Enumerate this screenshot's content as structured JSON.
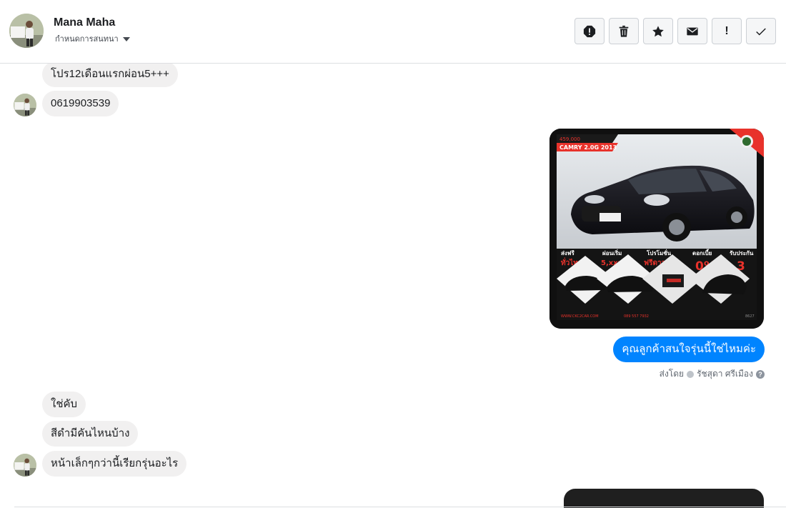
{
  "contact": {
    "name": "Mana Maha",
    "subtitle": "กำหนดการสนทนา"
  },
  "toolbar": {
    "buttons": [
      {
        "icon": "alert-circle-icon"
      },
      {
        "icon": "trash-icon"
      },
      {
        "icon": "star-icon"
      },
      {
        "icon": "envelope-icon"
      },
      {
        "icon": "exclamation-icon",
        "glyph": "!"
      },
      {
        "icon": "checkmark-icon"
      }
    ]
  },
  "messages": {
    "incoming_1": "โปร12เดือนแรกผ่อน5+++",
    "incoming_2": "0619903539",
    "outgoing_1": "คุณลูกค้าสนใจรุ่นนี้ใช่ไหมค่ะ",
    "incoming_3": "ใช่คับ",
    "incoming_4": "สีดำมีคันไหนบ้าง",
    "incoming_5": "หน้าเล็กๆกว่านี้เรียกรุ่นอะไร"
  },
  "photo": {
    "tag_price": "459,000",
    "tag_model": "CAMRY 2.0G 2013",
    "features": [
      {
        "title": "ส่งฟรี",
        "value": "ทั่วไทย"
      },
      {
        "title": "ผ่อนเริ่ม",
        "value": "5,xxx"
      },
      {
        "title": "โปรโมชั่น",
        "value": "ฟรีดาวน์"
      },
      {
        "title": "ดอกเบี้ย",
        "value": "0%"
      },
      {
        "title": "รับประกัน",
        "value": "3"
      }
    ],
    "footer_site": "WWW.CKC2CAR.COM",
    "footer_phone": "089 557 7932",
    "code": "8627"
  },
  "sent_by": {
    "label": "ส่งโดย",
    "agent": "รัชสุดา ศรีเมือง",
    "help": "?"
  },
  "colors": {
    "accent": "#0084ff",
    "incoming_bubble": "#f1f0f0",
    "promo_red": "#e8322b"
  }
}
